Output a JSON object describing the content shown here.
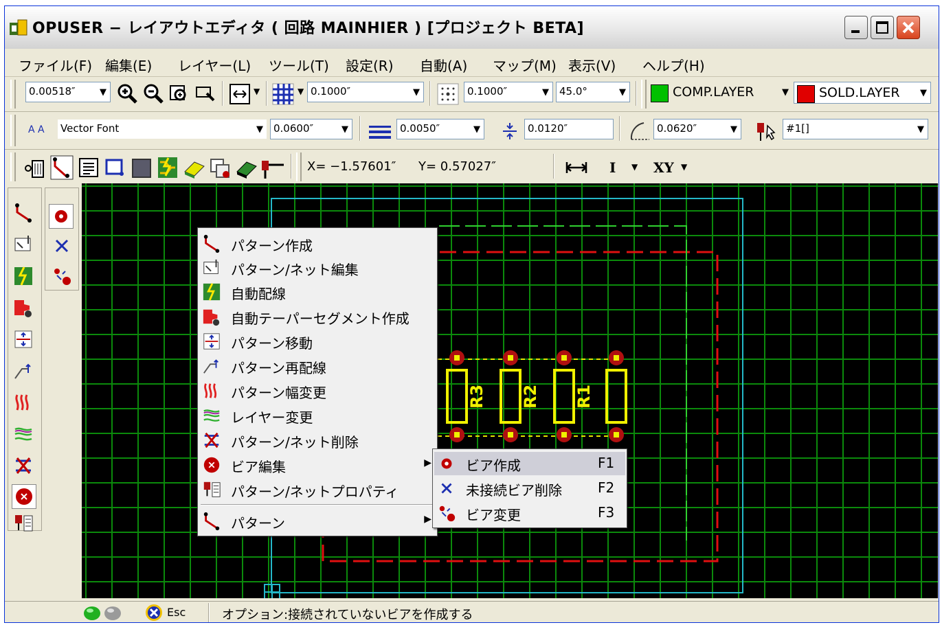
{
  "window": {
    "title": "OPUSER − レイアウトエディタ ( 回路 MAINHIER ) [プロジェクト BETA]"
  },
  "menubar": [
    "ファイル(F)",
    "編集(E)",
    "レイヤー(L)",
    "ツール(T)",
    "設定(R)",
    "自動(A)",
    "マップ(M)",
    "表示(V)",
    "ヘルプ(H)"
  ],
  "toolbar1": {
    "zoom": "0.00518″",
    "grid": "0.1000″",
    "snap_grid": "0.1000″",
    "angle": "45.0°",
    "comp_layer": "COMP.LAYER",
    "sold_layer": "SOLD.LAYER",
    "comp_color": "#00C000",
    "sold_color": "#E00000"
  },
  "toolbar2": {
    "font_prefix": "A A",
    "font": "Vector Font",
    "text_size": "0.0600″",
    "line_width": "0.0050″",
    "clearance": "0.0120″",
    "arc_size": "0.0620″",
    "net": "#1[]"
  },
  "toolbar3": {
    "x_coord": "X= −1.57601″",
    "y_coord": "Y= 0.57027″",
    "mode_i": "I",
    "mode_xy": "XY"
  },
  "context_menu": {
    "items": [
      {
        "label": "パターン作成",
        "icon": "pattern-create-icon"
      },
      {
        "label": "パターン/ネット編集",
        "icon": "pattern-net-edit-icon"
      },
      {
        "label": "自動配線",
        "icon": "auto-route-icon"
      },
      {
        "label": "自動テーパーセグメント作成",
        "icon": "auto-taper-segment-icon"
      },
      {
        "label": "パターン移動",
        "icon": "pattern-move-icon"
      },
      {
        "label": "パターン再配線",
        "icon": "pattern-reroute-icon"
      },
      {
        "label": "パターン幅変更",
        "icon": "pattern-width-change-icon"
      },
      {
        "label": "レイヤー変更",
        "icon": "layer-change-icon"
      },
      {
        "label": "パターン/ネット削除",
        "icon": "pattern-net-delete-icon"
      },
      {
        "label": "ビア編集",
        "icon": "via-edit-icon"
      },
      {
        "label": "パターン/ネットプロパティ",
        "icon": "pattern-net-property-icon"
      },
      {
        "label": "パターン",
        "icon": "pattern-icon"
      }
    ]
  },
  "via_submenu": {
    "items": [
      {
        "label": "ビア作成",
        "key": "F1"
      },
      {
        "label": "未接続ビア削除",
        "key": "F2"
      },
      {
        "label": "ビア変更",
        "key": "F3"
      }
    ]
  },
  "resistors": [
    "R3",
    "R2",
    "R1"
  ],
  "statusbar": {
    "esc": "Esc",
    "message": "オプション:接続されていないビアを作成する"
  }
}
